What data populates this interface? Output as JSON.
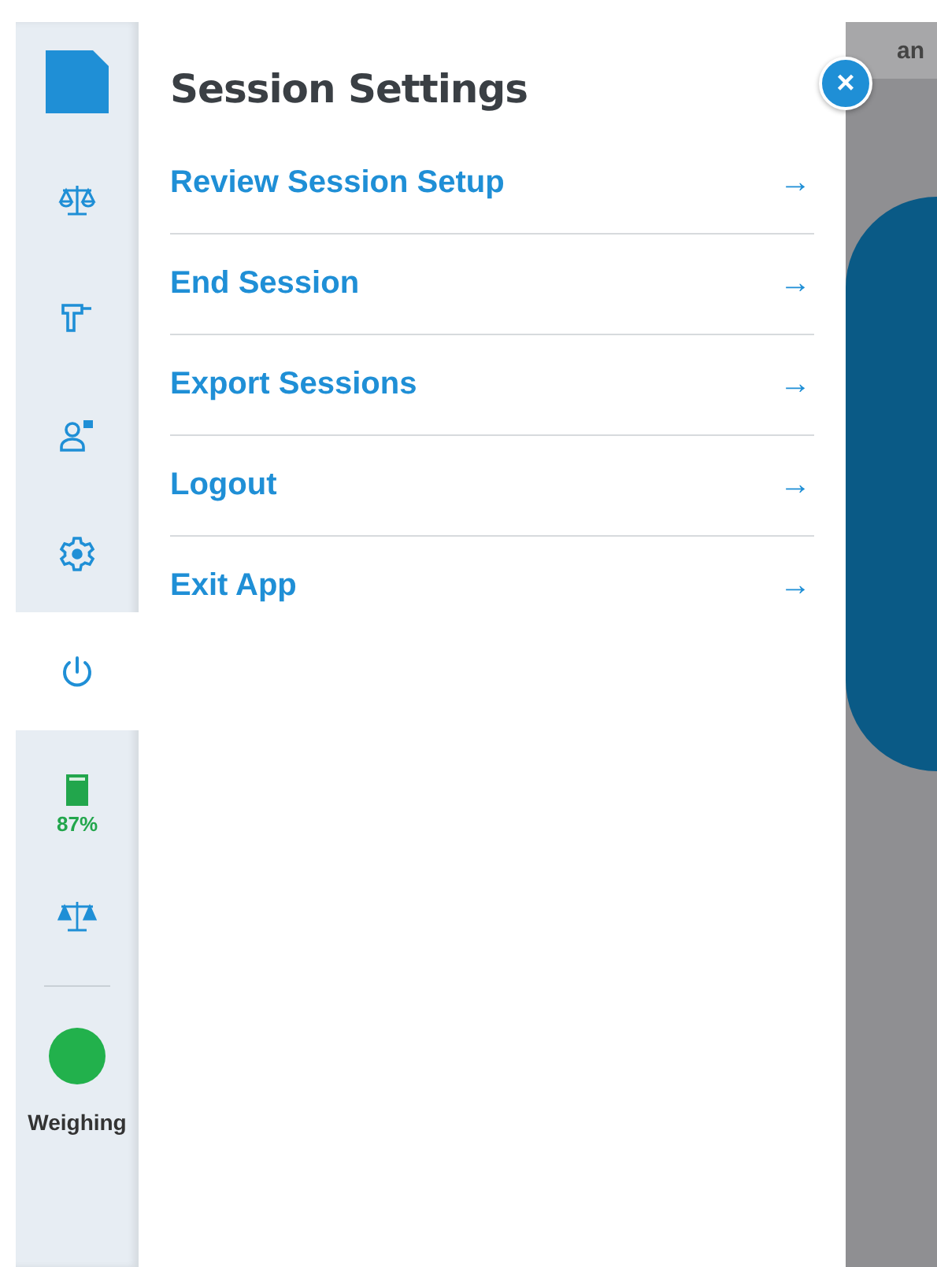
{
  "sidebar": {
    "items": [
      {
        "kind": "document",
        "selected": false
      },
      {
        "kind": "scale",
        "selected": false
      },
      {
        "kind": "tool",
        "selected": false
      },
      {
        "kind": "person",
        "selected": false
      },
      {
        "kind": "settings",
        "selected": false
      },
      {
        "kind": "power",
        "selected": true
      }
    ],
    "battery": {
      "level": 0.87,
      "reading": "87%"
    },
    "scale_status": {
      "kind": "scale-filled"
    },
    "status": {
      "color": "#22b14c",
      "label": "Weighing"
    }
  },
  "panel": {
    "title": "Session Settings",
    "items": [
      {
        "label": "Review Session Setup",
        "arrow": "→"
      },
      {
        "label": "End Session",
        "arrow": "→"
      },
      {
        "label": "Export Sessions",
        "arrow": "→"
      },
      {
        "label": "Logout",
        "arrow": "→"
      },
      {
        "label": "Exit App",
        "arrow": "→"
      }
    ],
    "close": "×"
  },
  "background": {
    "header_text": "an"
  }
}
